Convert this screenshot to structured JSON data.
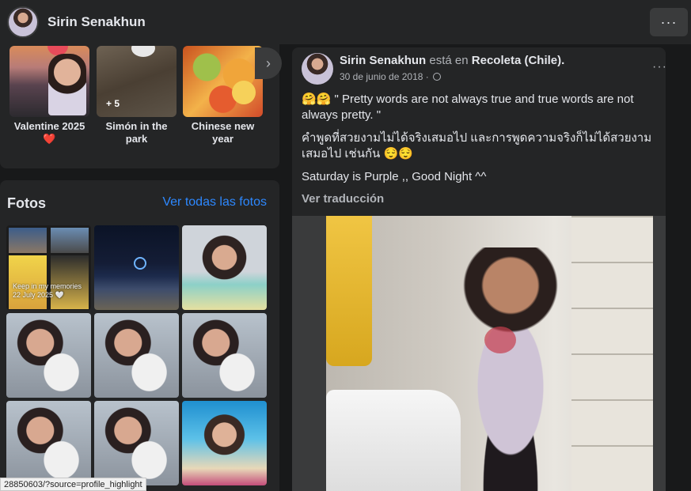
{
  "header": {
    "profile_name": "Sirin Senakhun",
    "more_label": "···"
  },
  "highlights": {
    "items": [
      {
        "label": "Valentine 2025 ❤️"
      },
      {
        "label": "Simón in the park",
        "overflow": "+ 5"
      },
      {
        "label": "Chinese new year"
      }
    ],
    "next_icon": "›"
  },
  "photos": {
    "title": "Fotos",
    "see_all": "Ver todas las fotos",
    "collage_caption": "Keep in my memories\n22 July 2025 🤍",
    "grid": [
      "collage",
      "night-harbor",
      "selfie",
      "selfie-rabbit",
      "selfie-rabbit",
      "selfie-rabbit",
      "selfie-rabbit",
      "selfie-rabbit",
      "selfie-beach"
    ]
  },
  "status_url": "28850603/?source=profile_highlight",
  "post": {
    "author": "Sirin Senakhun",
    "is_at": "está en",
    "place": "Recoleta (Chile).",
    "date": "30 de junio de 2018 ·",
    "more_label": "···",
    "paragraphs": [
      "🤗🤗 \" Pretty words are not always true and true words are not always pretty. \"",
      "คำพูดที่สวยงามไม่ได้จริงเสมอไป และการพูดความจริงก็ไม่ได้สวยงามเสมอไป เช่นกัน 😌😌",
      "Saturday is Purple ,, Good Night ^^"
    ],
    "translate_label": "Ver traducción"
  },
  "colors": {
    "background": "#18191a",
    "card": "#242526",
    "link": "#2d88ff",
    "text": "#e4e6eb",
    "muted": "#b0b3b8"
  }
}
